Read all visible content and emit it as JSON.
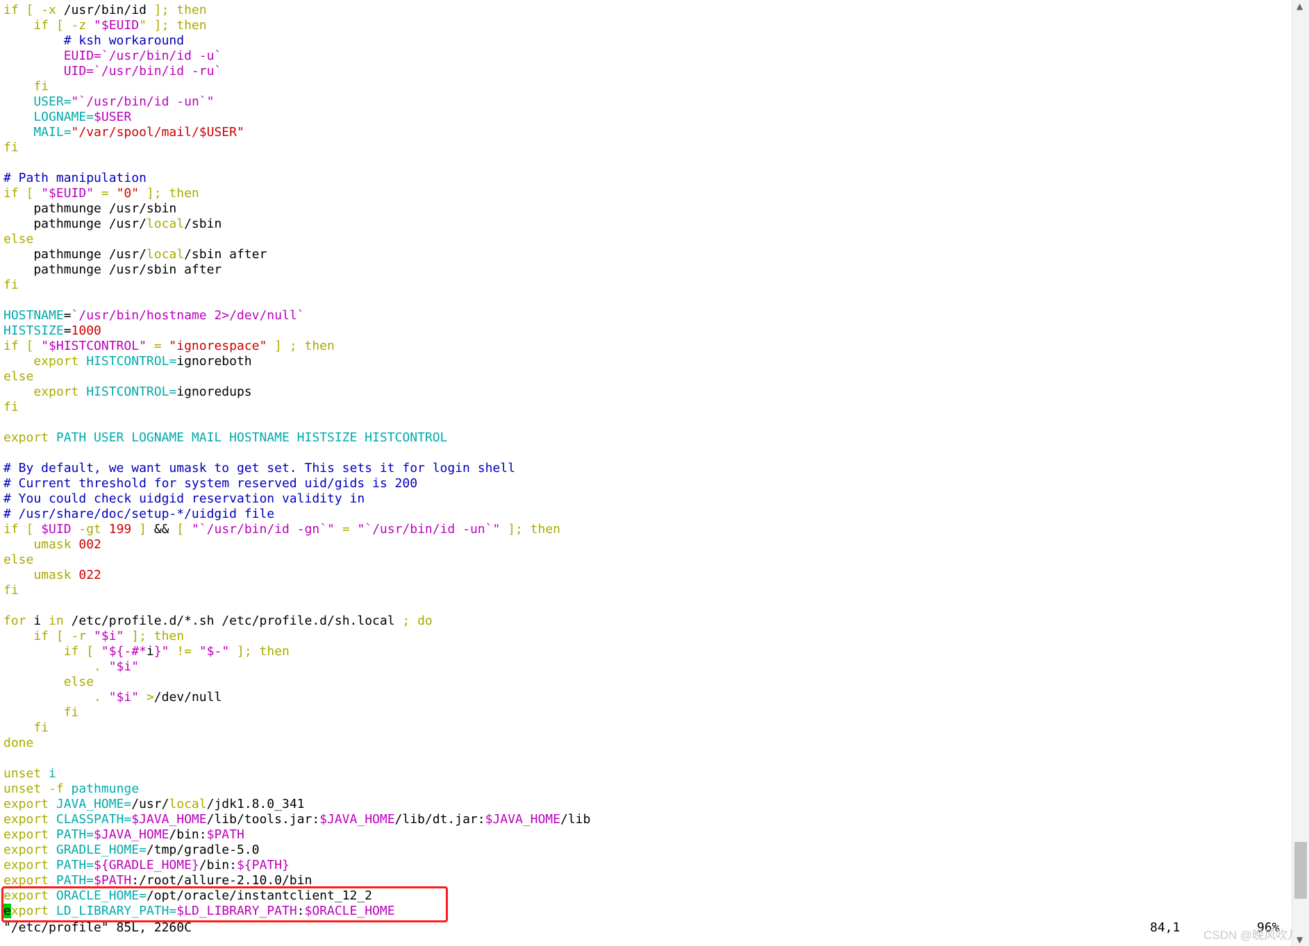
{
  "colors": {
    "yellow": "#aaaa00",
    "magenta": "#bb00bb",
    "blue": "#0000bb",
    "cyan": "#00aaaa",
    "red": "#cc0000",
    "black": "#000000",
    "cursor": "#00cc00",
    "highlight_box": "#ff1a1a"
  },
  "editor": {
    "lines": [
      [
        [
          "if [ -x ",
          "yellow"
        ],
        [
          "/usr/bin/id ",
          "black"
        ],
        [
          "]; then",
          "yellow"
        ]
      ],
      [
        [
          "    if [ -z ",
          "yellow"
        ],
        [
          "\"",
          "magenta"
        ],
        [
          "$EUID",
          "magenta"
        ],
        [
          "\" ]; then",
          "yellow"
        ]
      ],
      [
        [
          "        # ksh workaround",
          "blue"
        ]
      ],
      [
        [
          "        EUID=`/usr/bin/id -u`",
          "magenta"
        ]
      ],
      [
        [
          "        UID=`/usr/bin/id -ru`",
          "magenta"
        ]
      ],
      [
        [
          "    fi",
          "yellow"
        ]
      ],
      [
        [
          "    USER=",
          "cyan"
        ],
        [
          "\"`/usr/bin/id -un`\"",
          "magenta"
        ]
      ],
      [
        [
          "    LOGNAME=",
          "cyan"
        ],
        [
          "$USER",
          "magenta"
        ]
      ],
      [
        [
          "    MAIL=",
          "cyan"
        ],
        [
          "\"/var/spool/mail/$USER\"",
          "red"
        ]
      ],
      [
        [
          "fi",
          "yellow"
        ]
      ],
      [],
      [
        [
          "# Path manipulation",
          "blue"
        ]
      ],
      [
        [
          "if [ ",
          "yellow"
        ],
        [
          "\"$EUID\"",
          "magenta"
        ],
        [
          " = ",
          "yellow"
        ],
        [
          "\"0\"",
          "red"
        ],
        [
          " ]; then",
          "yellow"
        ]
      ],
      [
        [
          "    pathmunge /usr/sbin",
          "black"
        ]
      ],
      [
        [
          "    pathmunge /usr/",
          "black"
        ],
        [
          "local",
          "yellow"
        ],
        [
          "/sbin",
          "black"
        ]
      ],
      [
        [
          "else",
          "yellow"
        ]
      ],
      [
        [
          "    pathmunge /usr/",
          "black"
        ],
        [
          "local",
          "yellow"
        ],
        [
          "/sbin after",
          "black"
        ]
      ],
      [
        [
          "    pathmunge /usr/sbin after",
          "black"
        ]
      ],
      [
        [
          "fi",
          "yellow"
        ]
      ],
      [],
      [
        [
          "HOSTNAME",
          "cyan"
        ],
        [
          "=",
          "black"
        ],
        [
          "`/usr/bin/hostname 2>/dev/null`",
          "magenta"
        ]
      ],
      [
        [
          "HISTSIZE",
          "cyan"
        ],
        [
          "=",
          "black"
        ],
        [
          "1000",
          "red"
        ]
      ],
      [
        [
          "if [ ",
          "yellow"
        ],
        [
          "\"$HISTCONTROL\"",
          "magenta"
        ],
        [
          " = ",
          "yellow"
        ],
        [
          "\"ignorespace\"",
          "red"
        ],
        [
          " ] ; then",
          "yellow"
        ]
      ],
      [
        [
          "    export ",
          "yellow"
        ],
        [
          "HISTCONTROL=",
          "cyan"
        ],
        [
          "ignoreboth",
          "black"
        ]
      ],
      [
        [
          "else",
          "yellow"
        ]
      ],
      [
        [
          "    export ",
          "yellow"
        ],
        [
          "HISTCONTROL=",
          "cyan"
        ],
        [
          "ignoredups",
          "black"
        ]
      ],
      [
        [
          "fi",
          "yellow"
        ]
      ],
      [],
      [
        [
          "export ",
          "yellow"
        ],
        [
          "PATH USER LOGNAME MAIL HOSTNAME HISTSIZE HISTCONTROL",
          "cyan"
        ]
      ],
      [],
      [
        [
          "# By default, we want umask to get set. This sets it for login shell",
          "blue"
        ]
      ],
      [
        [
          "# Current threshold for system reserved uid/gids is 200",
          "blue"
        ]
      ],
      [
        [
          "# You could check uidgid reservation validity in",
          "blue"
        ]
      ],
      [
        [
          "# /usr/share/doc/setup-*/uidgid file",
          "blue"
        ]
      ],
      [
        [
          "if [ ",
          "yellow"
        ],
        [
          "$UID",
          "magenta"
        ],
        [
          " -gt ",
          "yellow"
        ],
        [
          "199",
          "red"
        ],
        [
          " ] ",
          "yellow"
        ],
        [
          "&&",
          "black"
        ],
        [
          " [ ",
          "yellow"
        ],
        [
          "\"`/usr/bin/id -gn`\"",
          "magenta"
        ],
        [
          " = ",
          "yellow"
        ],
        [
          "\"`/usr/bin/id -un`\"",
          "magenta"
        ],
        [
          " ]; then",
          "yellow"
        ]
      ],
      [
        [
          "    umask ",
          "yellow"
        ],
        [
          "002",
          "red"
        ]
      ],
      [
        [
          "else",
          "yellow"
        ]
      ],
      [
        [
          "    umask ",
          "yellow"
        ],
        [
          "022",
          "red"
        ]
      ],
      [
        [
          "fi",
          "yellow"
        ]
      ],
      [],
      [
        [
          "for ",
          "yellow"
        ],
        [
          "i",
          "black"
        ],
        [
          " in ",
          "yellow"
        ],
        [
          "/etc/profile.d/*.sh /etc/profile.d/sh.local ",
          "black"
        ],
        [
          "; do",
          "yellow"
        ]
      ],
      [
        [
          "    if [ -r ",
          "yellow"
        ],
        [
          "\"$i\"",
          "magenta"
        ],
        [
          " ]; then",
          "yellow"
        ]
      ],
      [
        [
          "        if [ ",
          "yellow"
        ],
        [
          "\"${-#*",
          "magenta"
        ],
        [
          "i",
          "black"
        ],
        [
          "}\"",
          "magenta"
        ],
        [
          " != ",
          "yellow"
        ],
        [
          "\"$-\"",
          "magenta"
        ],
        [
          " ]; then",
          "yellow"
        ]
      ],
      [
        [
          "            . ",
          "yellow"
        ],
        [
          "\"$i\"",
          "magenta"
        ]
      ],
      [
        [
          "        else",
          "yellow"
        ]
      ],
      [
        [
          "            . ",
          "yellow"
        ],
        [
          "\"$i\"",
          "magenta"
        ],
        [
          " >",
          "yellow"
        ],
        [
          "/dev/null",
          "black"
        ]
      ],
      [
        [
          "        fi",
          "yellow"
        ]
      ],
      [
        [
          "    fi",
          "yellow"
        ]
      ],
      [
        [
          "done",
          "yellow"
        ]
      ],
      [],
      [
        [
          "unset ",
          "yellow"
        ],
        [
          "i",
          "cyan"
        ]
      ],
      [
        [
          "unset -f ",
          "yellow"
        ],
        [
          "pathmunge",
          "cyan"
        ]
      ],
      [
        [
          "export ",
          "yellow"
        ],
        [
          "JAVA_HOME=",
          "cyan"
        ],
        [
          "/usr/",
          "black"
        ],
        [
          "local",
          "yellow"
        ],
        [
          "/jdk1.8.0_341",
          "black"
        ]
      ],
      [
        [
          "export ",
          "yellow"
        ],
        [
          "CLASSPATH=",
          "cyan"
        ],
        [
          "$JAVA_HOME",
          "magenta"
        ],
        [
          "/lib/tools.jar:",
          "black"
        ],
        [
          "$JAVA_HOME",
          "magenta"
        ],
        [
          "/lib/dt.jar:",
          "black"
        ],
        [
          "$JAVA_HOME",
          "magenta"
        ],
        [
          "/lib",
          "black"
        ]
      ],
      [
        [
          "export ",
          "yellow"
        ],
        [
          "PATH=",
          "cyan"
        ],
        [
          "$JAVA_HOME",
          "magenta"
        ],
        [
          "/bin:",
          "black"
        ],
        [
          "$PATH",
          "magenta"
        ]
      ],
      [
        [
          "export ",
          "yellow"
        ],
        [
          "GRADLE_HOME=",
          "cyan"
        ],
        [
          "/tmp/gradle-5.0",
          "black"
        ]
      ],
      [
        [
          "export ",
          "yellow"
        ],
        [
          "PATH=",
          "cyan"
        ],
        [
          "${GRADLE_HOME}",
          "magenta"
        ],
        [
          "/bin:",
          "black"
        ],
        [
          "${PATH}",
          "magenta"
        ]
      ],
      [
        [
          "export ",
          "yellow"
        ],
        [
          "PATH=",
          "cyan"
        ],
        [
          "$PATH",
          "magenta"
        ],
        [
          ":/root/allure-2.10.0/bin",
          "black"
        ]
      ],
      [
        [
          "export ",
          "yellow"
        ],
        [
          "ORACLE_HOME=",
          "cyan"
        ],
        [
          "/opt/oracle/instantclient_12_2",
          "black"
        ]
      ],
      [
        [
          "e",
          "cursor"
        ],
        [
          "xport ",
          "yellow"
        ],
        [
          "LD_LIBRARY_PATH=",
          "cyan"
        ],
        [
          "$LD_LIBRARY_PATH",
          "magenta"
        ],
        [
          ":",
          "black"
        ],
        [
          "$ORACLE_HOME",
          "magenta"
        ]
      ]
    ]
  },
  "status": {
    "file_info": "\"/etc/profile\" 85L, 2260C",
    "cursor_position": "84,1",
    "scroll_percent": "96%"
  },
  "watermark": "CSDN @晚风吹儿",
  "scrollbar": {
    "position_fraction": 0.96
  }
}
